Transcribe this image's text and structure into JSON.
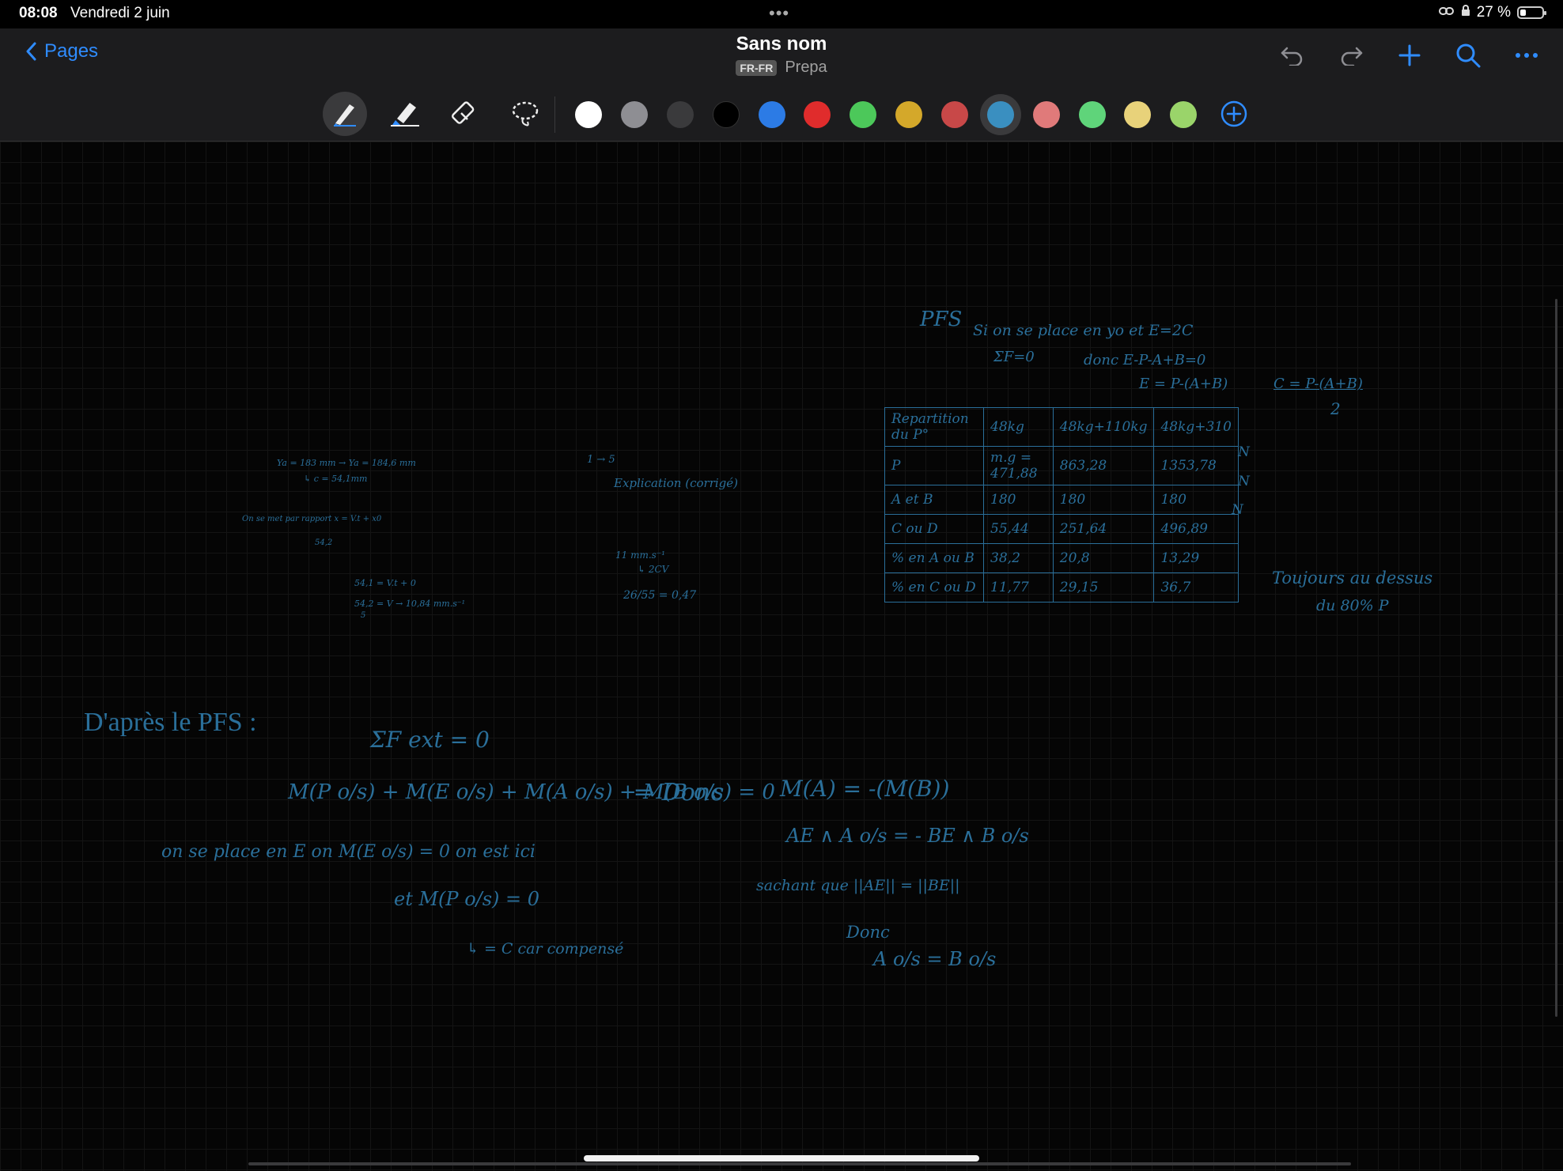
{
  "status": {
    "time": "08:08",
    "date": "Vendredi 2 juin",
    "battery": "27 %",
    "more_dots": "•••"
  },
  "nav": {
    "back_label": "Pages",
    "title": "Sans nom",
    "lang_badge": "FR-FR",
    "folder": "Prepa"
  },
  "toolbar": {
    "tools": [
      "pen-icon",
      "highlighter-icon",
      "eraser-icon",
      "lasso-icon"
    ],
    "colors": [
      "#ffffff",
      "#8e8e93",
      "#3a3a3c",
      "#000000",
      "#2c7be5",
      "#e02c2c",
      "#4cc85a",
      "#d4a82a",
      "#c84848",
      "#3a8fc0",
      "#e07a7a",
      "#5fd47a",
      "#e8d27a",
      "#9ad46a"
    ],
    "selected_color": "#3a8fc0"
  },
  "notes": {
    "pfs_title": "PFS",
    "pfs_line1": "Si on se place en yo et E=2C",
    "pfs_line2": "ΣF=0",
    "pfs_line3": "donc E-P-A+B=0",
    "pfs_line4": "E = P-(A+B)",
    "c_formula": "C = P-(A+B)",
    "c_den": "2",
    "toujours": "Toujours au dessus",
    "toujours2": "du 80% P",
    "left1": "Ya = 183 mm → Ya = 184,6 mm",
    "left2": "↳ c = 54,1mm",
    "left3": "On se met par rapport x = V.t + x0",
    "left4": "54,2",
    "left5": "54,1 = V.t + 0",
    "left6": "54,2 = V → 10,84 mm.s⁻¹",
    "left7": "5",
    "mid1": "1 → 5",
    "mid2": "Explication (corrigé)",
    "mid3": "11 mm.s⁻¹",
    "mid4": "↳ 2CV",
    "mid5": "26/55 = 0,47",
    "dapres": "D'après le PFS :",
    "sumF": "ΣF ext = 0",
    "moment_eq": "M(P o/s) + M(E o/s) + M(A o/s) + M(B o/s) = 0",
    "donc_arrow": "⇒ Donc",
    "donc_eq": "M(A) = -(M(B))",
    "ae_eq": "AE ∧ A o/s = - BE ∧ B o/s",
    "sachant": "sachant que ||AE|| = ||BE||",
    "donc2": "Donc",
    "final_eq": "A o/s = B o/s",
    "onse": "on se place en E on M(E o/s) = 0 on est ici",
    "et": "et M(P o/s) = 0",
    "comp": "↳ = C car compensé"
  },
  "table": {
    "headers": [
      "Repartition du P°",
      "48kg",
      "48kg+110kg",
      "48kg+310"
    ],
    "rows": [
      [
        "P",
        "m.g = 471,88",
        "863,28",
        "1353,78"
      ],
      [
        "A et B",
        "180",
        "180",
        "180"
      ],
      [
        "C ou D",
        "55,44",
        "251,64",
        "496,89"
      ],
      [
        "% en A ou B",
        "38,2",
        "20,8",
        "13,29"
      ],
      [
        "% en C ou D",
        "11,77",
        "29,15",
        "36,7"
      ]
    ],
    "units": [
      "N",
      "N",
      "N"
    ]
  }
}
